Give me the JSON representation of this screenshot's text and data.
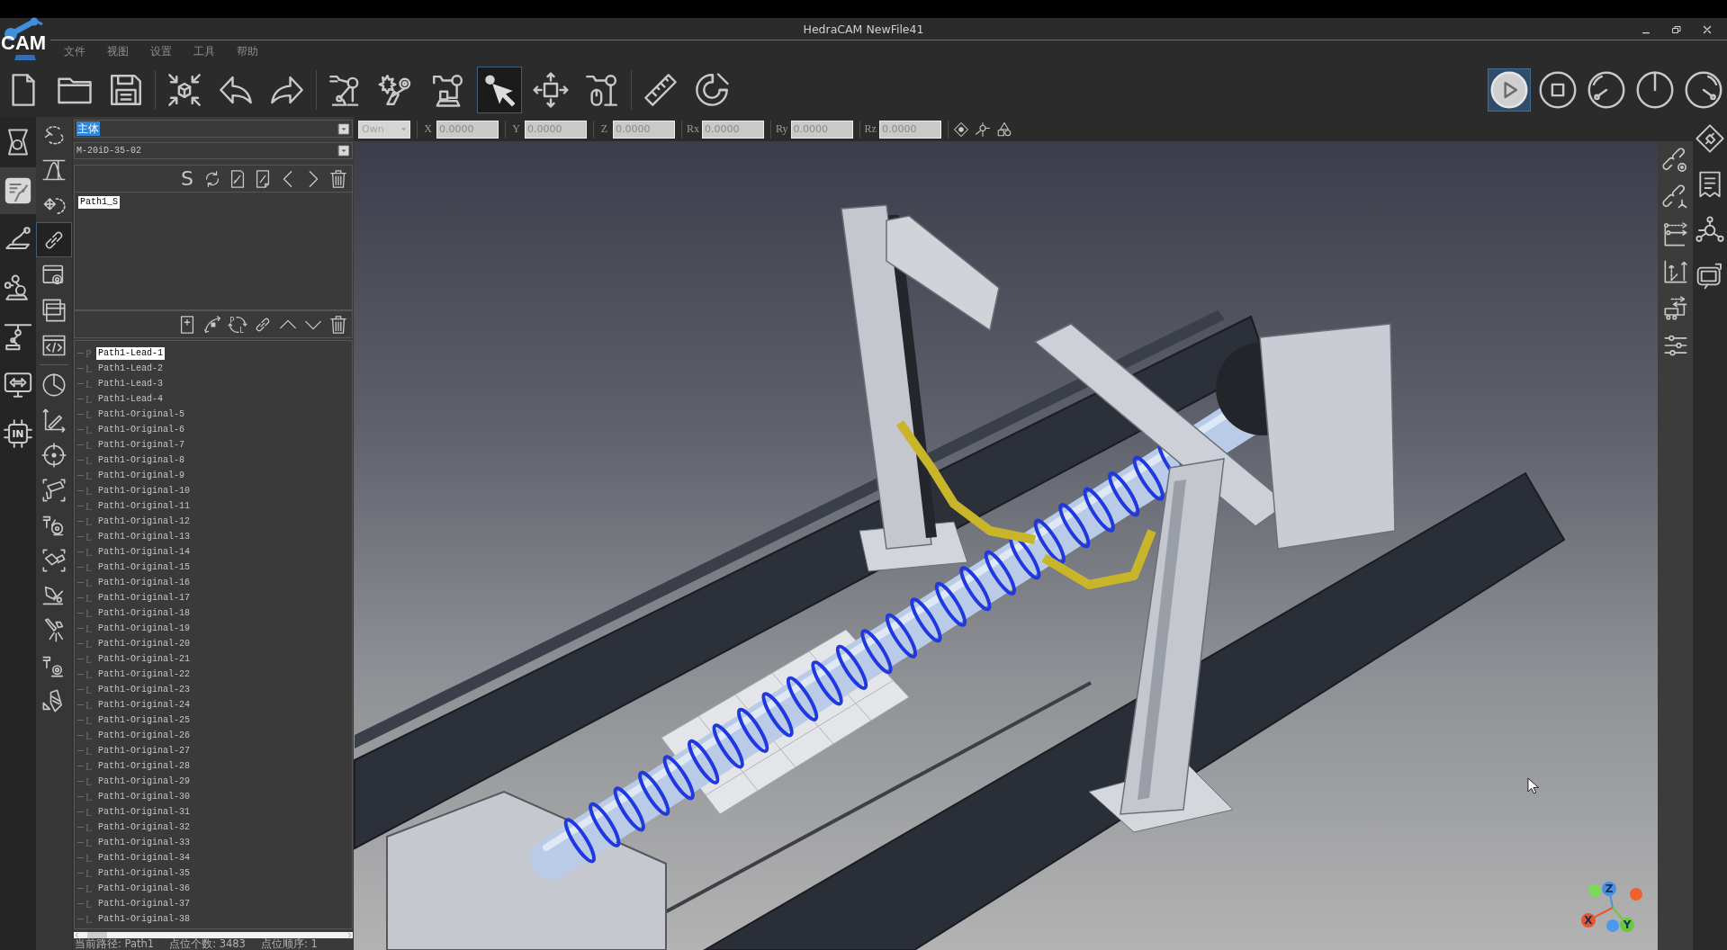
{
  "window": {
    "title": "HedraCAM NewFile41",
    "logo": "CAM"
  },
  "menu": [
    {
      "label": "文件"
    },
    {
      "label": "视图"
    },
    {
      "label": "设置"
    },
    {
      "label": "工具"
    },
    {
      "label": "帮助"
    }
  ],
  "toolbar": {
    "groups": [
      [
        {
          "selected": false
        },
        {
          "selected": false
        },
        {
          "selected": false
        }
      ],
      [
        {
          "selected": false
        },
        {
          "selected": false
        },
        {
          "selected": false
        }
      ],
      [
        {
          "selected": false
        },
        {
          "selected": false
        },
        {
          "selected": false
        },
        {
          "selected": true
        },
        {
          "selected": false
        },
        {
          "selected": false
        }
      ],
      [
        {
          "selected": false
        },
        {
          "selected": false
        }
      ]
    ],
    "run_controls": [
      {
        "selected": true
      },
      {
        "selected": false
      },
      {
        "selected": false
      },
      {
        "selected": false
      },
      {
        "selected": false
      }
    ]
  },
  "coords": {
    "frame_select": {
      "value": "Own"
    },
    "fields": [
      {
        "label": "X",
        "value": "0.0000"
      },
      {
        "label": "Y",
        "value": "0.0000"
      },
      {
        "label": "Z",
        "value": "0.0000"
      },
      {
        "label": "Rx",
        "value": "0.0000"
      },
      {
        "label": "Ry",
        "value": "0.0000"
      },
      {
        "label": "Rz",
        "value": "0.0000"
      }
    ]
  },
  "mode_rail": [
    {
      "selected": false
    },
    {
      "selected": true
    },
    {
      "selected": false
    },
    {
      "selected": false
    },
    {
      "selected": false
    },
    {
      "selected": false
    },
    {
      "selected": false,
      "text": "IN"
    }
  ],
  "tool_rail": [
    {
      "selected": false
    },
    {
      "selected": false
    },
    {
      "selected": false
    },
    {
      "selected": true
    },
    {
      "selected": false
    },
    {
      "selected": false
    },
    {
      "selected": false
    },
    {
      "selected": false
    },
    {
      "selected": false
    },
    {
      "selected": false
    },
    {
      "selected": false
    },
    {
      "selected": false
    },
    {
      "selected": false
    },
    {
      "selected": false
    },
    {
      "selected": false
    },
    {
      "selected": false
    },
    {
      "selected": false
    }
  ],
  "panel": {
    "body_select": {
      "value": "主体",
      "text_selected": true
    },
    "robot_select": {
      "value": "M-20iD-35-02"
    },
    "path_tools": {
      "letter": "S"
    },
    "paths": [
      {
        "label": "Path1_S",
        "selected": true
      }
    ],
    "point_tools": {
      "letters": [
        "P",
        "L"
      ]
    },
    "points": [
      {
        "type": "P",
        "label": "Path1-Lead-1",
        "selected": true
      },
      {
        "type": "L",
        "label": "Path1-Lead-2",
        "selected": false
      },
      {
        "type": "L",
        "label": "Path1-Lead-3",
        "selected": false
      },
      {
        "type": "L",
        "label": "Path1-Lead-4",
        "selected": false
      },
      {
        "type": "L",
        "label": "Path1-Original-5",
        "selected": false
      },
      {
        "type": "L",
        "label": "Path1-Original-6",
        "selected": false
      },
      {
        "type": "L",
        "label": "Path1-Original-7",
        "selected": false
      },
      {
        "type": "L",
        "label": "Path1-Original-8",
        "selected": false
      },
      {
        "type": "L",
        "label": "Path1-Original-9",
        "selected": false
      },
      {
        "type": "L",
        "label": "Path1-Original-10",
        "selected": false
      },
      {
        "type": "L",
        "label": "Path1-Original-11",
        "selected": false
      },
      {
        "type": "L",
        "label": "Path1-Original-12",
        "selected": false
      },
      {
        "type": "L",
        "label": "Path1-Original-13",
        "selected": false
      },
      {
        "type": "L",
        "label": "Path1-Original-14",
        "selected": false
      },
      {
        "type": "L",
        "label": "Path1-Original-15",
        "selected": false
      },
      {
        "type": "L",
        "label": "Path1-Original-16",
        "selected": false
      },
      {
        "type": "L",
        "label": "Path1-Original-17",
        "selected": false
      },
      {
        "type": "L",
        "label": "Path1-Original-18",
        "selected": false
      },
      {
        "type": "L",
        "label": "Path1-Original-19",
        "selected": false
      },
      {
        "type": "L",
        "label": "Path1-Original-20",
        "selected": false
      },
      {
        "type": "L",
        "label": "Path1-Original-21",
        "selected": false
      },
      {
        "type": "L",
        "label": "Path1-Original-22",
        "selected": false
      },
      {
        "type": "L",
        "label": "Path1-Original-23",
        "selected": false
      },
      {
        "type": "L",
        "label": "Path1-Original-24",
        "selected": false
      },
      {
        "type": "L",
        "label": "Path1-Original-25",
        "selected": false
      },
      {
        "type": "L",
        "label": "Path1-Original-26",
        "selected": false
      },
      {
        "type": "L",
        "label": "Path1-Original-27",
        "selected": false
      },
      {
        "type": "L",
        "label": "Path1-Original-28",
        "selected": false
      },
      {
        "type": "L",
        "label": "Path1-Original-29",
        "selected": false
      },
      {
        "type": "L",
        "label": "Path1-Original-30",
        "selected": false
      },
      {
        "type": "L",
        "label": "Path1-Original-31",
        "selected": false
      },
      {
        "type": "L",
        "label": "Path1-Original-32",
        "selected": false
      },
      {
        "type": "L",
        "label": "Path1-Original-33",
        "selected": false
      },
      {
        "type": "L",
        "label": "Path1-Original-34",
        "selected": false
      },
      {
        "type": "L",
        "label": "Path1-Original-35",
        "selected": false
      },
      {
        "type": "L",
        "label": "Path1-Original-36",
        "selected": false
      },
      {
        "type": "L",
        "label": "Path1-Original-37",
        "selected": false
      },
      {
        "type": "L",
        "label": "Path1-Original-38",
        "selected": false
      }
    ],
    "status": [
      "当前路径: Path1",
      "点位个数: 3483",
      "点位顺序: 1"
    ]
  },
  "viewport": {
    "axes": [
      {
        "label": "Z",
        "color": "#4a8fe0"
      },
      {
        "label": "X",
        "color": "#e8562a"
      },
      {
        "label": "Y",
        "color": "#6cc93c"
      }
    ]
  }
}
